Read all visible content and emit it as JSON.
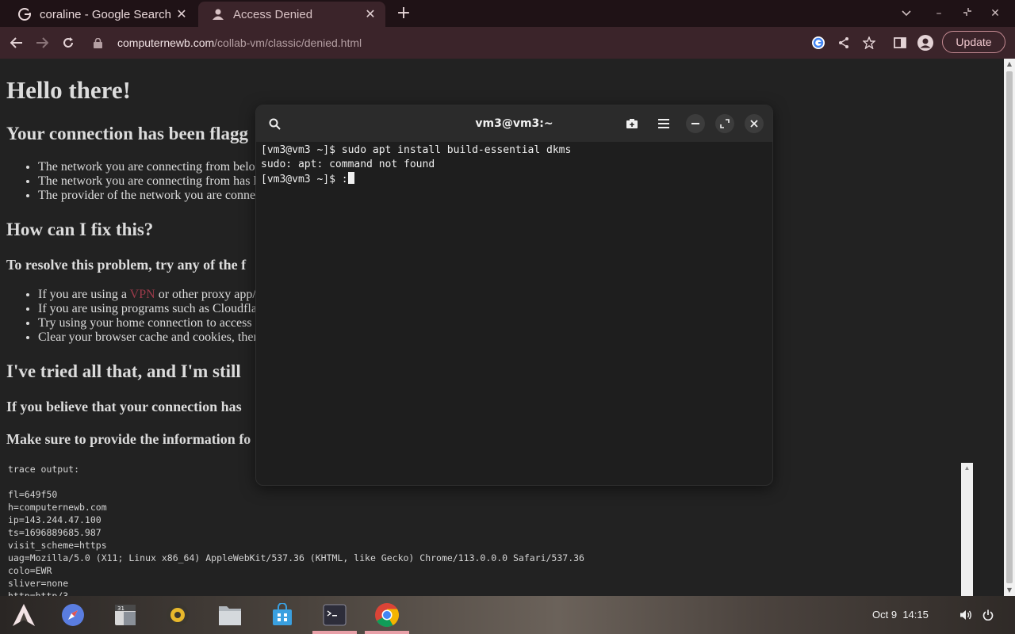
{
  "browser": {
    "tabs": [
      {
        "title": "coraline - Google Search",
        "favicon": "google-icon"
      },
      {
        "title": "Access Denied",
        "favicon": "shield-person-icon"
      }
    ],
    "new_tab": "+",
    "url_host": "computernewb.com",
    "url_path": "/collab-vm/classic/denied.html",
    "update_label": "Update"
  },
  "page": {
    "h1": "Hello there!",
    "h2_flagged": "Your connection has been flagg",
    "flag_items": [
      "The network you are connecting from belo",
      "The network you are connecting from has l",
      "The provider of the network you are conne"
    ],
    "h2_fix": "How can I fix this?",
    "h3_resolve": "To resolve this problem, try any of the f",
    "fix_items": {
      "vpn_prefix": "If you are using a ",
      "vpn_link": "VPN",
      "vpn_suffix": " or other proxy app/",
      "item2": "If you are using programs such as Cloudfla",
      "item3": "Try using your home connection to access",
      "item4": "Clear your browser cache and cookies, ther"
    },
    "h2_tried": "I've tried all that, and I'm still",
    "h3_believe": "If you believe that your connection has",
    "h3_provide": "Make sure to provide the information fo",
    "trace": {
      "header": "trace output:",
      "lines": [
        "fl=649f50",
        "h=computernewb.com",
        "ip=143.244.47.100",
        "ts=1696889685.987",
        "visit_scheme=https",
        "uag=Mozilla/5.0 (X11; Linux x86_64) AppleWebKit/537.36 (KHTML, like Gecko) Chrome/113.0.0.0 Safari/537.36",
        "colo=EWR",
        "sliver=none",
        "http=http/3"
      ]
    }
  },
  "terminal": {
    "title": "vm3@vm3:~",
    "lines": [
      "[vm3@vm3 ~]$ sudo apt install build-essential dkms",
      "sudo: apt: command not found"
    ],
    "prompt": "[vm3@vm3 ~]$ :"
  },
  "taskbar": {
    "apps": [
      "arch-launcher-icon",
      "web-browser-icon",
      "calendar-icon",
      "music-player-icon",
      "files-icon",
      "software-store-icon",
      "terminal-icon",
      "chrome-icon"
    ],
    "date": "Oct 9",
    "time": "14:15"
  }
}
